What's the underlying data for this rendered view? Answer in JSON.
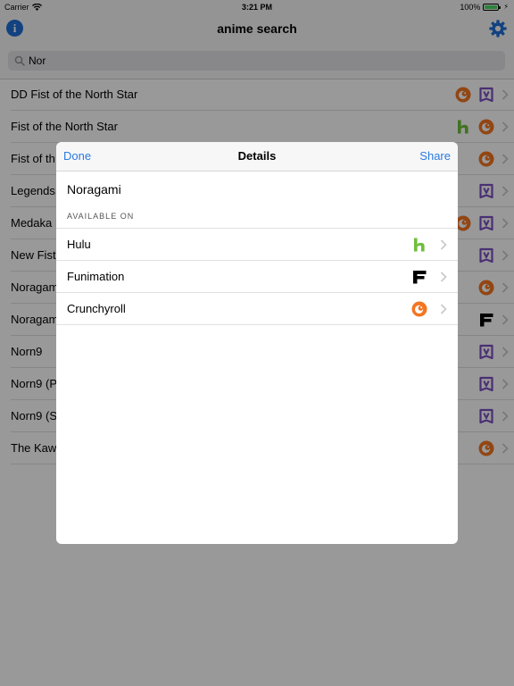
{
  "status": {
    "carrier": "Carrier",
    "time": "3:21 PM",
    "battery": "100%"
  },
  "nav": {
    "title": "anime search"
  },
  "search": {
    "value": "Nor"
  },
  "results": [
    {
      "title": "DD Fist of the North Star",
      "services": [
        "crunchyroll",
        "vrv"
      ]
    },
    {
      "title": "Fist of the North Star",
      "services": [
        "hulu",
        "crunchyroll"
      ]
    },
    {
      "title": "Fist of th",
      "services": [
        "crunchyroll"
      ]
    },
    {
      "title": "Legends",
      "services": [
        "vrv"
      ]
    },
    {
      "title": "Medaka B",
      "services": [
        "crunchyroll",
        "vrv"
      ]
    },
    {
      "title": "New Fist",
      "services": [
        "vrv"
      ]
    },
    {
      "title": "Noragam",
      "services": [
        "crunchyroll"
      ]
    },
    {
      "title": "Noragam",
      "services": [
        "funimation"
      ]
    },
    {
      "title": "Norn9",
      "services": [
        "vrv"
      ]
    },
    {
      "title": "Norn9 (P",
      "services": [
        "vrv"
      ]
    },
    {
      "title": "Norn9 (S",
      "services": [
        "vrv"
      ]
    },
    {
      "title": "The Kawa",
      "services": [
        "crunchyroll"
      ]
    }
  ],
  "details": {
    "done_label": "Done",
    "title": "Details",
    "share_label": "Share",
    "name": "Noragami",
    "section_label": "AVAILABLE ON",
    "services": [
      {
        "name": "Hulu",
        "icon": "hulu"
      },
      {
        "name": "Funimation",
        "icon": "funimation"
      },
      {
        "name": "Crunchyroll",
        "icon": "crunchyroll"
      }
    ]
  },
  "colors": {
    "accent": "#2a7ae2",
    "hulu": "#6fbe3a",
    "crunchyroll": "#f47521",
    "vrv": "#7b4fc2",
    "info": "#1f6fd6"
  }
}
